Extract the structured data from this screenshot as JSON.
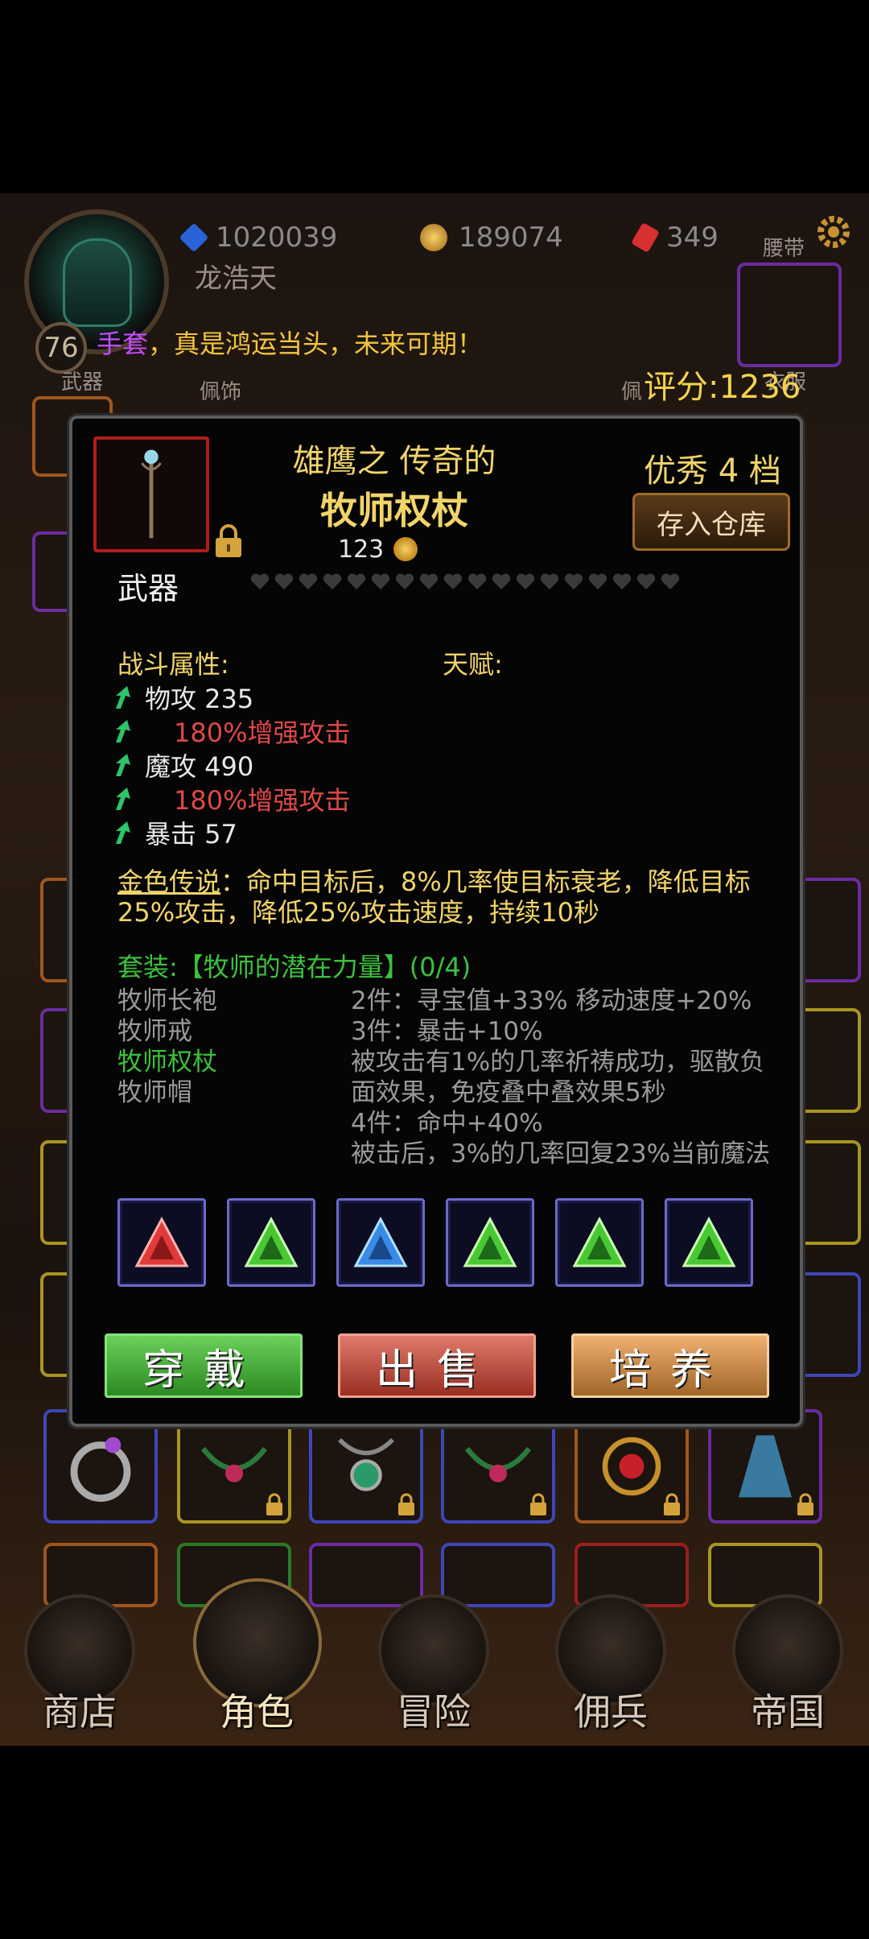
{
  "hud": {
    "level": "76",
    "resources": [
      {
        "icon": "blue-gem-icon",
        "value": "1020039",
        "color": "#2a62d8"
      },
      {
        "icon": "gold-coin-icon",
        "value": "189074",
        "color": "#d8a030"
      },
      {
        "icon": "red-crystal-icon",
        "value": "349",
        "color": "#d83030"
      }
    ],
    "player_name": "龙浩天",
    "announcement_highlight": "手套",
    "announcement_text": "，真是鸿运当头，未来可期！",
    "waist_label": "腰带",
    "score": "评分:1236",
    "slot_labels": {
      "weapon": "武器",
      "accessory": "佩饰",
      "accessory2": "佩",
      "armor": "衣服"
    }
  },
  "item": {
    "name_prefix": "雄鹰之 传奇的",
    "name": "牧师权杖",
    "price": "123",
    "grade": "优秀 4 档",
    "store_button": "存入仓库",
    "slot_type": "武器",
    "hearts_total": 18,
    "combat_label": "战斗属性:",
    "talent_label": "天赋:",
    "stats": [
      {
        "text": "物攻 235",
        "emphasis": false
      },
      {
        "text": "180%增强攻击",
        "emphasis": true
      },
      {
        "text": "魔攻 490",
        "emphasis": false
      },
      {
        "text": "180%增强攻击",
        "emphasis": true
      },
      {
        "text": "暴击 57",
        "emphasis": false
      }
    ],
    "legend_label": "金色传说",
    "legend_text": "：命中目标后，8%几率使目标衰老，降低目标25%攻击，降低25%攻击速度，持续10秒",
    "set_title": "套装:【牧师的潜在力量】(0/4)",
    "set_pieces": [
      {
        "name": "牧师长袍",
        "equipped": false
      },
      {
        "name": "牧师戒",
        "equipped": false
      },
      {
        "name": "牧师权杖",
        "equipped": true
      },
      {
        "name": "牧师帽",
        "equipped": false
      }
    ],
    "set_bonuses": [
      "2件：寻宝值+33% 移动速度+20%",
      "3件：暴击+10%",
      "被攻击有1%的几率祈祷成功，驱散负面效果，免疫叠中叠效果5秒",
      "4件：命中+40%",
      "被击后，3%的几率回复23%当前魔法值"
    ],
    "gems": [
      {
        "icon": "red-gem-icon",
        "color": "#e03a3a"
      },
      {
        "icon": "green-gem-icon",
        "color": "#4ac834"
      },
      {
        "icon": "blue-gem-icon",
        "color": "#3a8ae8"
      },
      {
        "icon": "green-gem-icon",
        "color": "#4ac834"
      },
      {
        "icon": "green-gem-icon",
        "color": "#4ac834"
      },
      {
        "icon": "green-gem-icon",
        "color": "#4ac834"
      }
    ],
    "buttons": {
      "equip": "穿戴",
      "sell": "出售",
      "upgrade": "培养"
    }
  },
  "nav": [
    {
      "label": "商店",
      "icon": "shop-castle-icon",
      "active": false
    },
    {
      "label": "角色",
      "icon": "character-hood-icon",
      "active": true
    },
    {
      "label": "冒险",
      "icon": "crossed-swords-icon",
      "active": false
    },
    {
      "label": "佣兵",
      "icon": "mercenary-card-icon",
      "active": false
    },
    {
      "label": "帝国",
      "icon": "crown-icon",
      "active": false
    }
  ]
}
